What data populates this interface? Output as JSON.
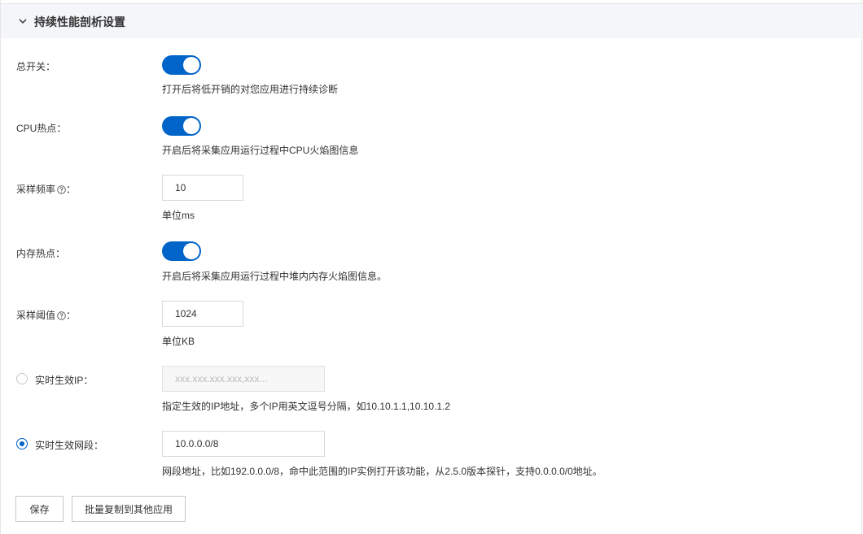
{
  "header": {
    "title": "持续性能剖析设置"
  },
  "fields": {
    "master_switch": {
      "label": "总开关：",
      "on": true,
      "help": "打开后将低开销的对您应用进行持续诊断"
    },
    "cpu_hotspot": {
      "label": "CPU热点：",
      "on": true,
      "help": "开启后将采集应用运行过程中CPU火焰图信息"
    },
    "sample_freq": {
      "label": "采样频率",
      "colon": "：",
      "value": "10",
      "help": "单位ms"
    },
    "memory_hotspot": {
      "label": "内存热点：",
      "on": true,
      "help": "开启后将采集应用运行过程中堆内内存火焰图信息。"
    },
    "sample_threshold": {
      "label": "采样阈值",
      "colon": "：",
      "value": "1024",
      "help": "单位KB"
    },
    "realtime_ip": {
      "label": "实时生效IP：",
      "selected": false,
      "placeholder": "xxx.xxx.xxx.xxx,xxx...",
      "help": "指定生效的IP地址，多个IP用英文逗号分隔，如10.10.1.1,10.10.1.2"
    },
    "realtime_segment": {
      "label": "实时生效网段：",
      "selected": true,
      "value": "10.0.0.0/8",
      "help": "网段地址，比如192.0.0.0/8，命中此范围的IP实例打开该功能，从2.5.0版本探针，支持0.0.0.0/0地址。"
    }
  },
  "actions": {
    "save": "保存",
    "batch_copy": "批量复制到其他应用"
  },
  "colors": {
    "primary": "#0064c8",
    "header_bg": "#f4f6f9",
    "border": "#d9d9d9"
  }
}
